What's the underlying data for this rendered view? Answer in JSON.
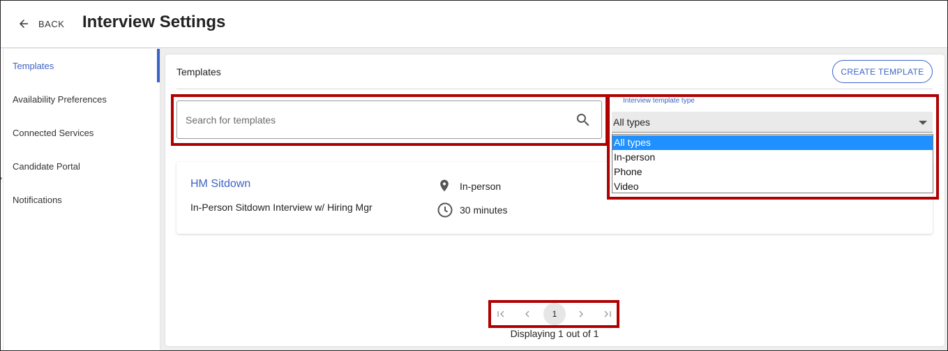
{
  "header": {
    "back_label": "BACK",
    "title": "Interview Settings"
  },
  "sidebar": {
    "items": [
      {
        "label": "Templates",
        "active": true
      },
      {
        "label": "Availability Preferences"
      },
      {
        "label": "Connected Services"
      },
      {
        "label": "Candidate Portal"
      },
      {
        "label": "Notifications"
      }
    ]
  },
  "main": {
    "section_title": "Templates",
    "create_button": "CREATE TEMPLATE",
    "search": {
      "placeholder": "Search for templates",
      "value": ""
    },
    "type_filter": {
      "label": "Interview template type",
      "selected": "All types",
      "options": [
        "All types",
        "In-person",
        "Phone",
        "Video"
      ]
    },
    "templates": [
      {
        "name": "HM Sitdown",
        "description": "In-Person Sitdown Interview w/ Hiring Mgr",
        "type": "In-person",
        "duration": "30 minutes"
      }
    ],
    "pagination": {
      "current_page": "1",
      "status": "Displaying 1 out of 1"
    }
  },
  "colors": {
    "accent": "#3a62c8",
    "highlight": "#b00000",
    "selected_option": "#1e90ff"
  },
  "icons": [
    "arrow-left-icon",
    "search-icon",
    "chevron-down-icon",
    "location-pin-icon",
    "clock-icon",
    "first-page-icon",
    "prev-page-icon",
    "next-page-icon",
    "last-page-icon"
  ]
}
